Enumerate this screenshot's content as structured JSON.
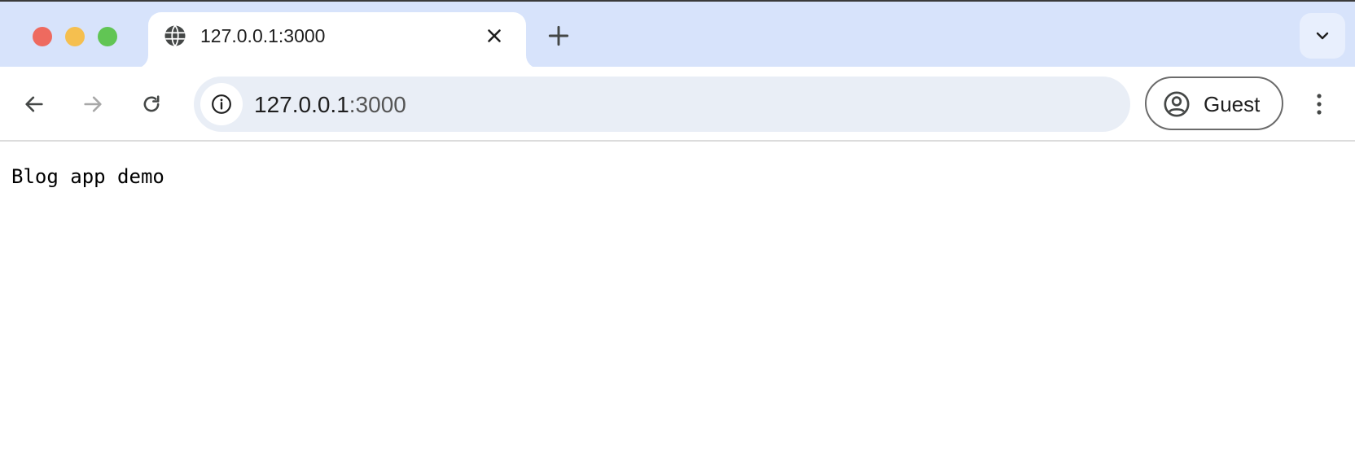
{
  "window": {
    "controls": [
      "close",
      "minimize",
      "maximize"
    ]
  },
  "tabs": [
    {
      "title": "127.0.0.1:3000",
      "icon": "globe-icon",
      "active": true
    }
  ],
  "tabstrip": {
    "new_tab_icon": "plus-icon",
    "tab_search_icon": "chevron-down-icon"
  },
  "toolbar": {
    "back_icon": "arrow-left-icon",
    "forward_icon": "arrow-right-icon",
    "reload_icon": "reload-icon",
    "omnibox": {
      "host": "127.0.0.1",
      "port": ":3000",
      "site_info_icon": "info-icon"
    },
    "profile": {
      "label": "Guest",
      "icon": "account-circle-icon"
    },
    "menu_icon": "kebab-menu-icon"
  },
  "page": {
    "text": "Blog app demo"
  },
  "colors": {
    "tabstrip_bg": "#d7e3fb",
    "omnibox_bg": "#e9eef6",
    "close": "#ee6a5f",
    "minimize": "#f5bf4f",
    "maximize": "#61c554"
  }
}
